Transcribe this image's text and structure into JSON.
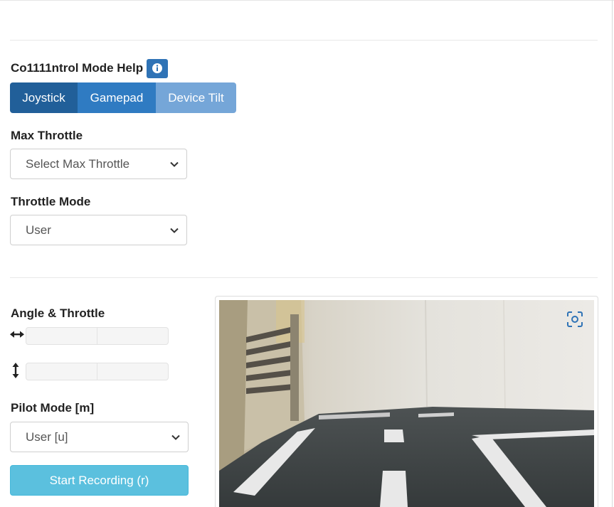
{
  "control_mode": {
    "title": "Co1111ntrol Mode Help",
    "info_icon": "info-icon",
    "modes": [
      {
        "label": "Joystick",
        "state": "active"
      },
      {
        "label": "Gamepad",
        "state": "normal"
      },
      {
        "label": "Device Tilt",
        "state": "disabled"
      }
    ]
  },
  "max_throttle": {
    "label": "Max Throttle",
    "selected": "Select Max Throttle"
  },
  "throttle_mode": {
    "label": "Throttle Mode",
    "selected": "User"
  },
  "angle_throttle": {
    "label": "Angle & Throttle",
    "angle_icon": "horizontal-arrow-icon",
    "throttle_icon": "vertical-arrow-icon"
  },
  "pilot_mode": {
    "label": "Pilot Mode [m]",
    "selected": "User [u]"
  },
  "record_button": {
    "label": "Start Recording (r)"
  },
  "video": {
    "fullscreen_icon": "fullscreen-capture-icon"
  },
  "colors": {
    "primary_dark": "#215f99",
    "primary": "#2f7bc2",
    "primary_light": "#75a6d8",
    "info": "#5bc0de"
  }
}
